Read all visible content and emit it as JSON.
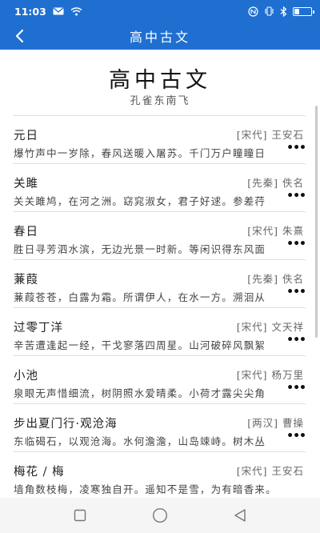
{
  "status": {
    "time": "11:03",
    "battery_level": 0.25
  },
  "nav": {
    "title": "高中古文"
  },
  "page": {
    "title": "高中古文",
    "subtitle": "孔雀东南飞"
  },
  "poems": [
    {
      "title": "元日",
      "meta": "[宋代] 王安石",
      "excerpt": "爆竹声中一岁除，春风送暖入屠苏。千门万户瞳瞳日"
    },
    {
      "title": "关雎",
      "meta": "[先秦] 佚名",
      "excerpt": "关关雎鸠，在河之洲。窈窕淑女，君子好逑。参差荇"
    },
    {
      "title": "春日",
      "meta": "[宋代] 朱熹",
      "excerpt": "胜日寻芳泗水滨，无边光景一时新。等闲识得东风面"
    },
    {
      "title": "蒹葭",
      "meta": "[先秦] 佚名",
      "excerpt": "蒹葭苍苍，白露为霜。所谓伊人，在水一方。溯洄从"
    },
    {
      "title": "过零丁洋",
      "meta": "[宋代] 文天祥",
      "excerpt": "辛苦遭逢起一经，干戈寥落四周星。山河破碎风飘絮"
    },
    {
      "title": "小池",
      "meta": "[宋代] 杨万里",
      "excerpt": "泉眼无声惜细流，树阴照水爱晴柔。小荷才露尖尖角"
    },
    {
      "title": "步出夏门行·观沧海",
      "meta": "[两汉] 曹操",
      "excerpt": "东临碣石，以观沧海。水何澹澹，山岛竦峙。树木丛"
    },
    {
      "title": "梅花 / 梅",
      "meta": "[宋代] 王安石",
      "excerpt": "墙角数枝梅，凌寒独自开。遥知不是雪，为有暗香来。"
    }
  ],
  "more_glyph": "•••",
  "colors": {
    "brand": "#1f6fd0",
    "divider": "#e0e0e0"
  }
}
